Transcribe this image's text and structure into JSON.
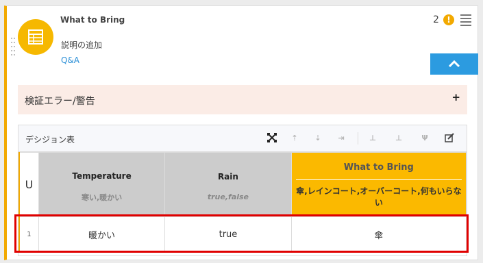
{
  "header": {
    "title": "What to Bring",
    "description": "説明の追加",
    "link": "Q&A",
    "warning_count": "2",
    "warning_icon": "!"
  },
  "alert": {
    "label": "検証エラー/警告",
    "toggle": "+"
  },
  "decision_table": {
    "label": "デシジョン表",
    "hit_policy": "U",
    "toolbar_icons": [
      "expand-icon",
      "add-rule-above-icon",
      "add-rule-below-icon",
      "remove-rule-icon",
      "add-input-icon",
      "add-output-icon",
      "remove-column-icon",
      "edit-icon"
    ],
    "columns": [
      {
        "name": "Temperature",
        "values": "寒い,暖かい"
      },
      {
        "name": "Rain",
        "values": "true,false"
      }
    ],
    "output": {
      "name": "What to Bring",
      "values": "傘,レインコート,オーバーコート,何もいらない"
    },
    "rows": [
      {
        "index": "1",
        "temperature": "暖かい",
        "rain": "true",
        "output": "傘"
      }
    ]
  },
  "colors": {
    "accent": "#f2a900",
    "button": "#2c9be0",
    "highlight": "#e00000",
    "input_header": "#cccccc",
    "output_header": "#fbb900"
  }
}
